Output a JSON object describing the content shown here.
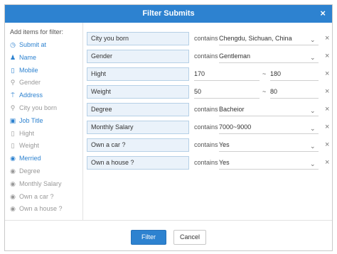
{
  "dialog": {
    "title": "Filter Submits",
    "close_glyph": "×"
  },
  "sidebar": {
    "heading": "Add items for filter:",
    "items": [
      {
        "label": "Submit at",
        "icon": "clock-icon",
        "glyph": "◷",
        "active": true
      },
      {
        "label": "Name",
        "icon": "person-icon",
        "glyph": "♟",
        "active": true
      },
      {
        "label": "Mobile",
        "icon": "phone-icon",
        "glyph": "▯",
        "active": true
      },
      {
        "label": "Gender",
        "icon": "gender-icon",
        "glyph": "⚲",
        "active": false
      },
      {
        "label": "Address",
        "icon": "signpost-icon",
        "glyph": "⍑",
        "active": true
      },
      {
        "label": "City you born",
        "icon": "location-pin-icon",
        "glyph": "⚲",
        "active": false
      },
      {
        "label": "Job Title",
        "icon": "briefcase-icon",
        "glyph": "▣",
        "active": true
      },
      {
        "label": "Hight",
        "icon": "ruler-icon",
        "glyph": "▯",
        "active": false
      },
      {
        "label": "Weight",
        "icon": "weight-icon",
        "glyph": "▯",
        "active": false
      },
      {
        "label": "Merried",
        "icon": "radio-icon",
        "glyph": "◉",
        "active": true
      },
      {
        "label": "Degree",
        "icon": "radio-icon",
        "glyph": "◉",
        "active": false
      },
      {
        "label": "Monthly Salary",
        "icon": "radio-icon",
        "glyph": "◉",
        "active": false
      },
      {
        "label": "Own a car ?",
        "icon": "radio-icon",
        "glyph": "◉",
        "active": false
      },
      {
        "label": "Own a house ?",
        "icon": "radio-icon",
        "glyph": "◉",
        "active": false
      }
    ]
  },
  "filters": [
    {
      "field": "City you born",
      "op": "contains",
      "value": "Chengdu, Sichuan, China",
      "type": "select"
    },
    {
      "field": "Gender",
      "op": "contains",
      "value": "Gentleman",
      "type": "select"
    },
    {
      "field": "Hight",
      "type": "range",
      "from": "170",
      "sep": "~",
      "to": "180"
    },
    {
      "field": "Weight",
      "type": "range",
      "from": "50",
      "sep": "~",
      "to": "80"
    },
    {
      "field": "Degree",
      "op": "contains",
      "value": "Bacheior",
      "type": "select"
    },
    {
      "field": "Monthly Salary",
      "op": "contains",
      "value": "7000~9000",
      "type": "select"
    },
    {
      "field": "Own a car ?",
      "op": "contains",
      "value": "Yes",
      "type": "select"
    },
    {
      "field": "Own a house ?",
      "op": "contains",
      "value": "Yes",
      "type": "select"
    }
  ],
  "remove_glyph": "×",
  "chevron_glyph": "⌄",
  "footer": {
    "filter_label": "Filter",
    "cancel_label": "Cancel"
  },
  "colors": {
    "accent": "#2d82d0",
    "field_bg": "#eaf2fa",
    "inactive": "#999999"
  }
}
